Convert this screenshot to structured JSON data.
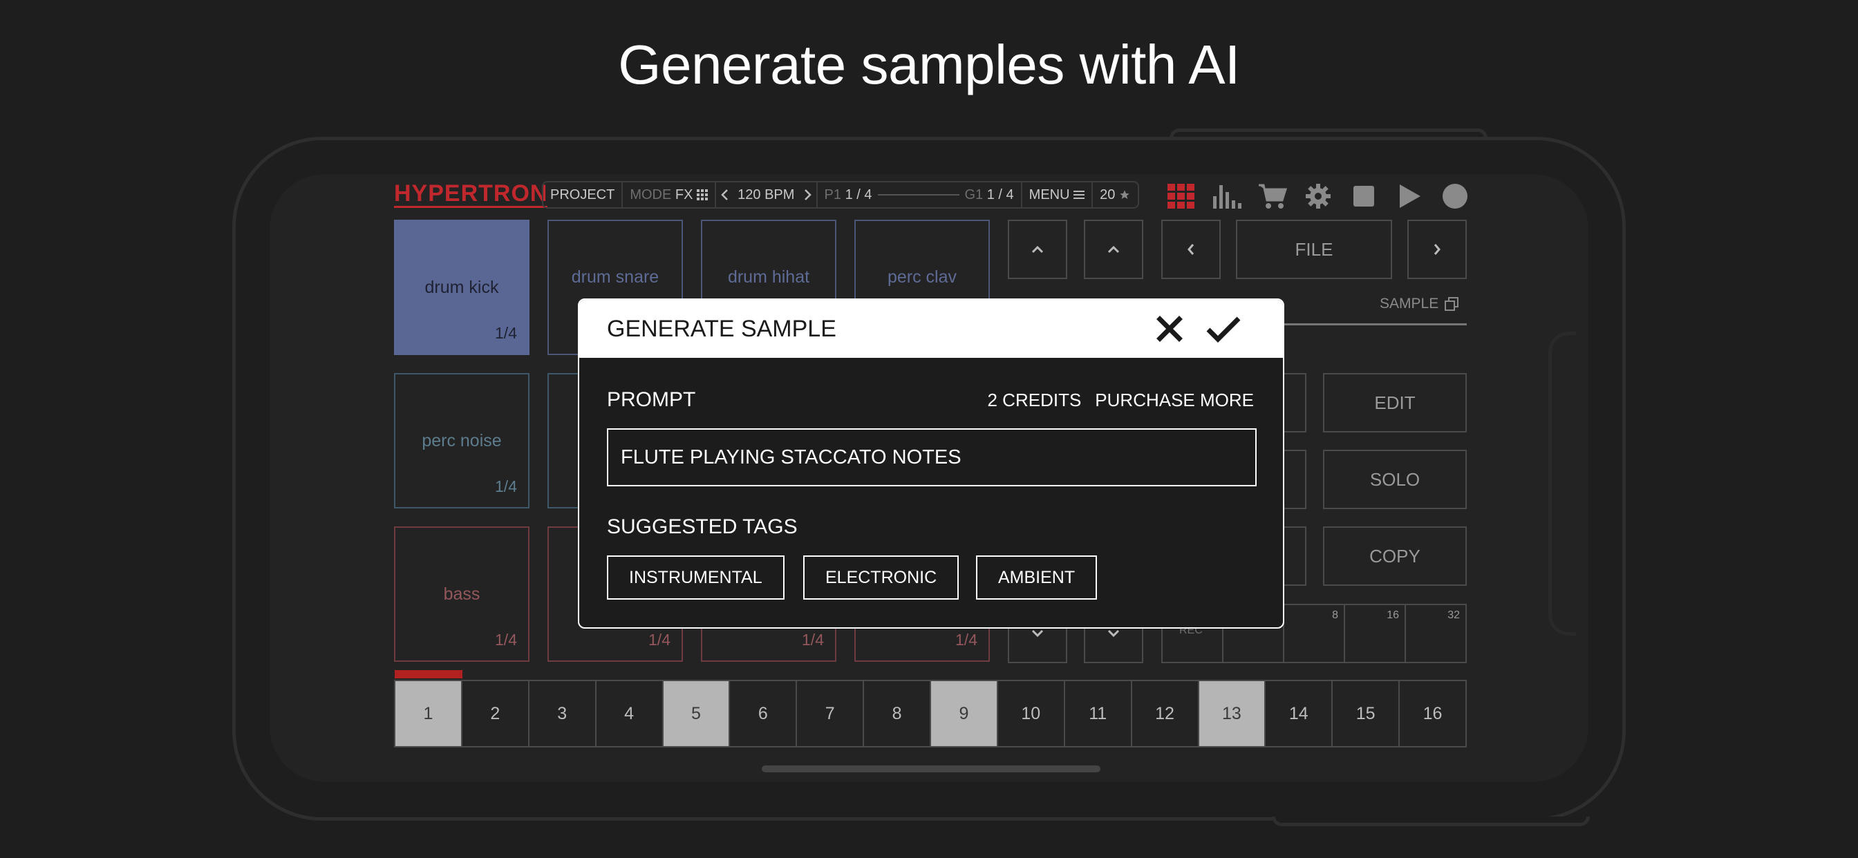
{
  "headline": "Generate samples with AI",
  "app": {
    "logo": "HYPERTRON",
    "topbar": {
      "project": "PROJECT",
      "mode_label": "MODE",
      "mode_value": "FX",
      "bpm": "120 BPM",
      "pattern_label": "P1",
      "pattern_value": "1 / 4",
      "group_label": "G1",
      "group_value": "1 / 4",
      "menu": "MENU",
      "rating": "20"
    },
    "toolbar_icons": [
      "grid-icon",
      "bars-icon",
      "cart-icon",
      "gear-icon",
      "stop-icon",
      "play-icon",
      "record-icon"
    ],
    "accent_red": "#c0282d",
    "pads": [
      {
        "label": "drum kick",
        "frac": "1/4"
      },
      {
        "label": "drum snare",
        "frac": ""
      },
      {
        "label": "drum hihat",
        "frac": ""
      },
      {
        "label": "perc clav",
        "frac": ""
      },
      {
        "label": "perc noise",
        "frac": "1/4"
      },
      {
        "label": "bass",
        "frac": "1/4"
      },
      {
        "frac": "1/4"
      },
      {
        "frac": "1/4"
      },
      {
        "frac": "1/4"
      }
    ],
    "file_label": "FILE",
    "sample_label": "SAMPLE",
    "side_buttons": {
      "edit": "EDIT",
      "solo": "SOLO",
      "copy": "COPY"
    },
    "rec_label": "REC",
    "length_options": [
      "8",
      "16",
      "32"
    ],
    "steps": [
      "1",
      "2",
      "3",
      "4",
      "5",
      "6",
      "7",
      "8",
      "9",
      "10",
      "11",
      "12",
      "13",
      "14",
      "15",
      "16"
    ],
    "active_steps": [
      1,
      5,
      9,
      13
    ]
  },
  "modal": {
    "title": "GENERATE SAMPLE",
    "prompt_label": "PROMPT",
    "credits": "2 CREDITS",
    "purchase": "PURCHASE MORE",
    "prompt_value": "FLUTE PLAYING STACCATO NOTES",
    "tags_label": "SUGGESTED TAGS",
    "tags": [
      "INSTRUMENTAL",
      "ELECTRONIC",
      "AMBIENT"
    ]
  }
}
